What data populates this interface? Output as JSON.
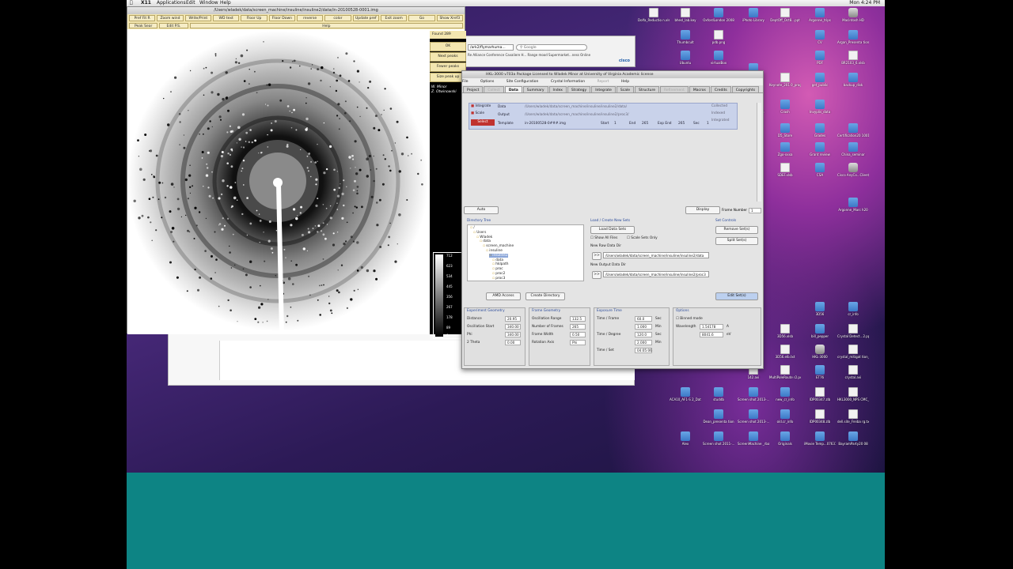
{
  "menubar": {
    "app": "X11",
    "items": [
      "Applications",
      "Edit",
      "Window",
      "Help"
    ],
    "clock": "Mon 4:24 PM"
  },
  "x11": {
    "title": "/Users/wladek/data/screen_machine/insuline/insuline2/data/in-20100528-0001.img",
    "toolbar": [
      "Pref Fit R",
      "Zoom wind",
      "Write/Print",
      "WD text",
      "Floor Up",
      "Floor Down",
      "reverse",
      "color",
      "Update pref",
      "Exit zoom",
      "Go",
      "Show Xref3"
    ],
    "row2": [
      "Peak Sear",
      "Edit P.S.",
      "Help"
    ],
    "found_label": "Found",
    "found_value": "289",
    "side_buttons": [
      "OK",
      "Next peaks",
      "Fewer peaks",
      "Size peak up"
    ],
    "names": [
      "W. Minor",
      "Z. Otwinowski"
    ],
    "scale_values": [
      "712",
      "623",
      "534",
      "445",
      "356",
      "267",
      "178",
      "89",
      "0"
    ]
  },
  "browser": {
    "address": "/ark2/flymarhuma...",
    "search_placeholder": "Google",
    "bookmarks": "Re Alliance   Conference   Cavaliere H...   Range mood   Supermarket...ness Online",
    "logo": "cisco"
  },
  "hkl": {
    "title": "HKL-3000 v703a     Package Licensed to Wladek Minor at University of Virginia     Academic license",
    "menu": [
      "File",
      "Options",
      "Site Configuration",
      "Crystal Information",
      "Report",
      "Help"
    ],
    "menu_dim": [
      false,
      false,
      false,
      false,
      true,
      false
    ],
    "tabs": [
      "Project",
      "Collect",
      "Data",
      "Summary",
      "Index",
      "Strategy",
      "Integrate",
      "Scale",
      "Structure",
      "Refinement",
      "Macros",
      "Credits",
      "Copyrights"
    ],
    "tabs_dim": [
      false,
      true,
      false,
      false,
      false,
      false,
      false,
      false,
      false,
      true,
      false,
      false,
      false
    ],
    "active_tab": "Data",
    "dataset": {
      "integrate": "Integrate",
      "scale": "Scale",
      "select": "Select",
      "data_label": "Data",
      "data_path": "/Users/wladek/data/screen_machine/insuline/insuline2/data/",
      "output_label": "Output",
      "output_path": "/Users/wladek/data/screen_machine/insuline/insuline2/proc3/",
      "template_label": "Template",
      "template_value": "in-20100528-0###.img",
      "start_label": "Start",
      "start_value": "1",
      "end_label": "End",
      "end_value": "265",
      "exp_end_label": "Exp End",
      "exp_end_value": "265",
      "sec_label": "Sec",
      "sec_value": "1",
      "collected": "Collected",
      "indexed": "Indexed",
      "integrated": "Integrated"
    },
    "auto_button": "Auto",
    "display_button": "Display",
    "frame_number_label": "Frame Number",
    "frame_number_value": "1",
    "dir_tree_label": "Directory Tree",
    "dir_tree": [
      "/",
      "Users",
      "Wladek",
      "data",
      "screen_machine",
      "insuline",
      "insuline2",
      "data",
      "hklpath",
      "proc",
      "proc2",
      "proc3"
    ],
    "load_label": "Load / Create New Sets",
    "load_button": "Load Data Sets",
    "show_all_files": "Show All Files",
    "scale_sets_only": "Scale Sets Only",
    "raw_dir_label": "New Raw Data Dir",
    "raw_dir_value": "/Users/wladek/data/screen_machine/insuline/insuline2/data",
    "out_dir_label": "New Output Data Dir",
    "out_dir_value": "/Users/wladek/data/screen_machine/insuline/insuline2/proc3",
    "arrow_btn": ">>",
    "set_controls_label": "Set Controls",
    "remove_button": "Remove Set(s)",
    "split_button": "Split Set(s)",
    "edit_button": "Edit Set(s)",
    "amd_button": "AMD Access",
    "create_dir_button": "Create Directory",
    "exp_geom": {
      "label": "Experiment Geometry",
      "distance_label": "Distance",
      "distance_value": "20.95",
      "osc_start_label": "Oscillation Start",
      "osc_start_value": "340.00",
      "phi_label": "Phi",
      "phi_value": "340.00",
      "two_theta_label": "2 Theta",
      "two_theta_value": "0.00"
    },
    "frame_geom": {
      "label": "Frame Geometry",
      "osc_range_label": "Oscillation Range",
      "osc_range_value": "132.5",
      "num_frames_label": "Number of Frames",
      "num_frames_value": "265",
      "frame_width_label": "Frame Width",
      "frame_width_value": "0.50",
      "rot_axis_label": "Rotation Axis",
      "rot_axis_value": "Phi"
    },
    "exposure": {
      "label": "Exposure Time",
      "tf_label": "Time / Frame",
      "tf_value": "60.0",
      "tf_unit": "Sec",
      "tf2_value": "1.000",
      "tf2_unit": "Min",
      "td_label": "Time / Degree",
      "td_value": "120.0",
      "td_unit": "Sec",
      "td2_value": "2.000",
      "td2_unit": "Min",
      "ts_label": "Time / Set",
      "ts_value": "04:05:06"
    },
    "options": {
      "label": "Options",
      "binned": "Binned mode",
      "wavelength_label": "Wavelength",
      "wavelength_value": "1.54178",
      "wavelength_unit": "A",
      "ev_value": "8041.6",
      "ev_unit": "eV"
    }
  },
  "desktop_icons": [
    "Dolfa_Reductio n.xlsx",
    "bhesl_lab.key",
    "OxfordLondon 2008",
    "iPhoto Library",
    "DeptOff_Oct8...ppt",
    "Argonne_trips",
    "Macintosh HD",
    "Thumbcult",
    "pdb.png",
    "CV",
    "Argan_Presenta tion",
    "Ubuntu",
    "virtualBox",
    "PDF",
    "BR2103_6.xlsb",
    "d375",
    "Keynote_201 0_program.pdf",
    "get_public",
    "backup_disk",
    "Login...ablem",
    "Crash",
    "Invyplis_data",
    "D5_Store",
    "Grades",
    "Certification20 10013...ortfog",
    "Zgo-xxxa",
    "Grant review",
    "China_seminar",
    "SDEF.xlsb",
    "CSA",
    "Cisco AnyCo...Client",
    "3D56",
    "cr_info",
    "3D56.xlsb",
    "bill_pepper",
    "Crystal Detect...2.pptx",
    "3D56.elb.txt",
    "HKL-3000",
    "crystal_mitigat tion_j...ist.ppt",
    "ET76",
    "crystal.avi",
    "142.avi",
    "MultiPoleRoute r2.pdf",
    "HKL3000_NPS CMC_s...02.zip",
    "ACA10_AF1-S 2_Data",
    "studdb",
    "Screen shot 2013-...41 PM",
    "new_cr_info",
    "IDP00347.zlb",
    "Dean_presenta tion",
    "Screen shot 2013-...04 PM",
    "old.cr_info",
    "IDP00348.zlb",
    "dell.site_Freiba rg.txt",
    "Alex",
    "Screen shot 2011-...46 AM",
    "ScreenMachine _rbac..._tested",
    "Originals",
    "iMovie Temp...07637",
    "BayramParty20 08",
    "Argonne_Marc h20"
  ]
}
